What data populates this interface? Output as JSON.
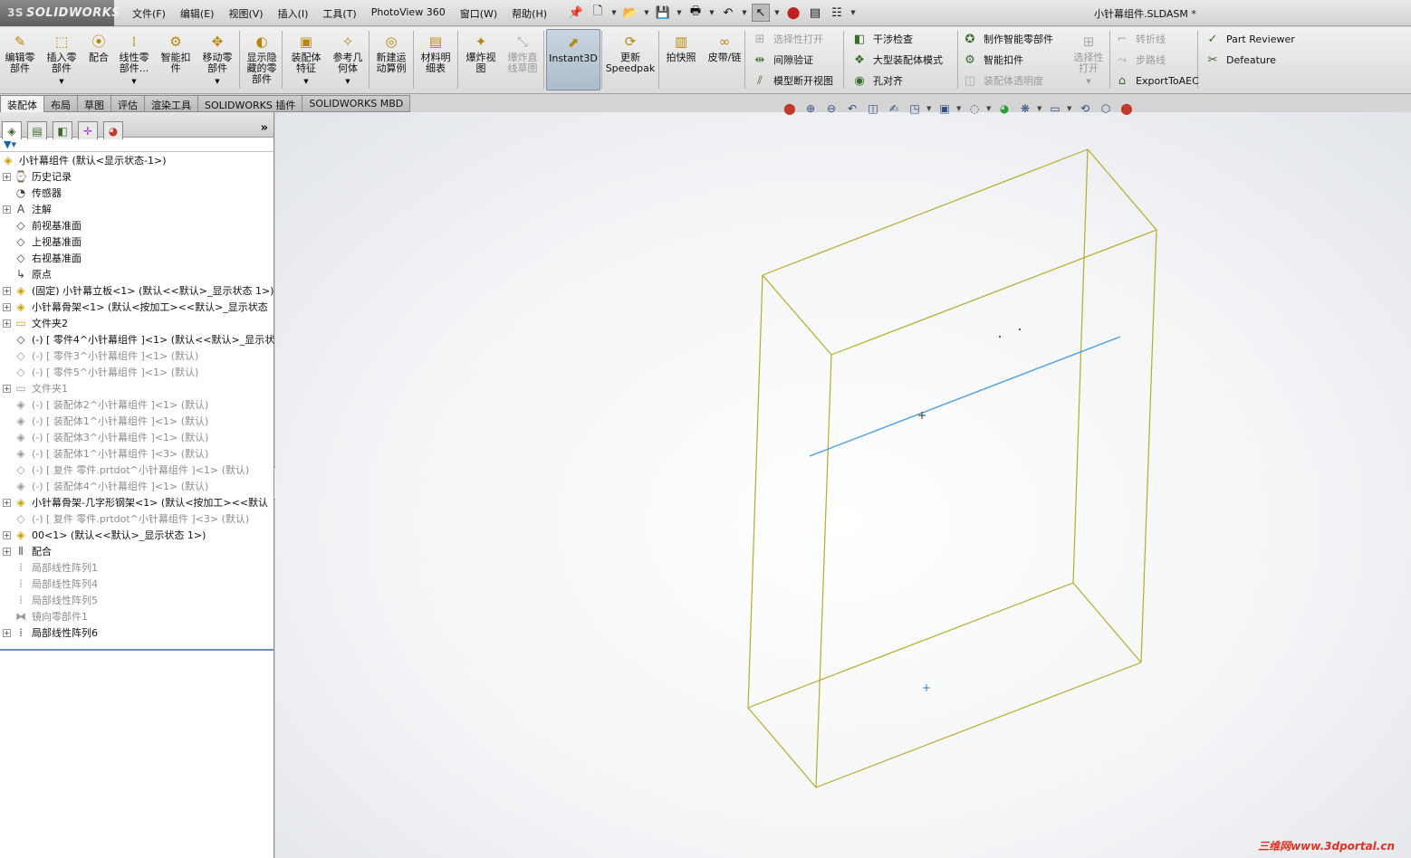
{
  "app": {
    "logo_text": "SOLIDWORKS",
    "logo_mark": "3S",
    "document_title": "小针幕组件.SLDASM *",
    "watermark": "三维网www.3dportal.cn"
  },
  "menu": [
    "文件(F)",
    "编辑(E)",
    "视图(V)",
    "插入(I)",
    "工具(T)",
    "PhotoView 360",
    "窗口(W)",
    "帮助(H)"
  ],
  "ribbon": {
    "large_buttons": [
      {
        "name": "edit-component-button",
        "label": "编辑零\n部件",
        "icon": "✎",
        "dropdown": false,
        "state": "normal"
      },
      {
        "name": "insert-components-button",
        "label": "插入零\n部件",
        "icon": "⬚",
        "dropdown": true,
        "state": "normal"
      },
      {
        "name": "mate-button",
        "label": "配合",
        "icon": "⦿",
        "dropdown": false,
        "state": "normal"
      },
      {
        "name": "linear-pattern-button",
        "label": "线性零\n部件...",
        "icon": "⁞",
        "dropdown": true,
        "state": "normal"
      },
      {
        "name": "smart-fasteners-button",
        "label": "智能扣\n件",
        "icon": "⚙",
        "dropdown": false,
        "state": "normal"
      },
      {
        "name": "move-component-button",
        "label": "移动零\n部件",
        "icon": "✥",
        "dropdown": true,
        "state": "normal"
      },
      {
        "name": "show-hidden-components-button",
        "label": "显示隐\n藏的零\n部件",
        "icon": "◐",
        "dropdown": false,
        "state": "normal"
      },
      {
        "name": "assembly-features-button",
        "label": "装配体\n特征",
        "icon": "▣",
        "dropdown": true,
        "state": "normal"
      },
      {
        "name": "reference-geometry-button",
        "label": "参考几\n何体",
        "icon": "✧",
        "dropdown": true,
        "state": "normal"
      },
      {
        "name": "new-motion-study-button",
        "label": "新建运\n动算例",
        "icon": "◎",
        "dropdown": false,
        "state": "normal"
      },
      {
        "name": "bill-of-materials-button",
        "label": "材料明\n细表",
        "icon": "▤",
        "dropdown": false,
        "state": "normal"
      },
      {
        "name": "exploded-view-button",
        "label": "爆炸视\n图",
        "icon": "✦",
        "dropdown": false,
        "state": "normal"
      },
      {
        "name": "explode-line-sketch-button",
        "label": "爆炸直\n线草图",
        "icon": "⤡",
        "dropdown": false,
        "state": "disabled"
      },
      {
        "name": "instant3d-button",
        "label": "Instant3D",
        "icon": "⬈",
        "dropdown": false,
        "state": "active"
      },
      {
        "name": "update-speedpak-button",
        "label": "更新\nSpeedpak",
        "icon": "⟳",
        "dropdown": false,
        "state": "normal"
      },
      {
        "name": "take-snapshot-button",
        "label": "拍快照",
        "icon": "▥",
        "dropdown": false,
        "state": "normal"
      },
      {
        "name": "belt-chain-button",
        "label": "皮带/链",
        "icon": "∞",
        "dropdown": false,
        "state": "normal"
      }
    ],
    "small_buttons": [
      {
        "name": "selective-open-button",
        "label": "选择性打开",
        "icon": "⊞",
        "state": "disabled"
      },
      {
        "name": "clearance-verification-button",
        "label": "间隙验证",
        "icon": "⇹",
        "state": "normal"
      },
      {
        "name": "model-break-view-button",
        "label": "模型断开视图",
        "icon": "⫽",
        "state": "normal"
      },
      {
        "name": "interference-detection-button",
        "label": "干涉检查",
        "icon": "◧",
        "state": "normal"
      },
      {
        "name": "large-assembly-mode-button",
        "label": "大型装配体模式",
        "icon": "❖",
        "state": "normal"
      },
      {
        "name": "hole-alignment-button",
        "label": "孔对齐",
        "icon": "◉",
        "state": "normal"
      },
      {
        "name": "make-smart-component-button",
        "label": "制作智能零部件",
        "icon": "✪",
        "state": "normal"
      },
      {
        "name": "smart-fasteners-small-button",
        "label": "智能扣件",
        "icon": "⚙",
        "state": "normal"
      },
      {
        "name": "assembly-transparency-button",
        "label": "装配体透明度",
        "icon": "◫",
        "state": "disabled"
      },
      {
        "name": "jog-line-button",
        "label": "转折线",
        "icon": "⌐",
        "state": "disabled"
      },
      {
        "name": "route-line-button",
        "label": "步路线",
        "icon": "⤳",
        "state": "disabled"
      },
      {
        "name": "export-to-aec-button",
        "label": "ExportToAEC",
        "icon": "⌂",
        "state": "normal"
      },
      {
        "name": "part-reviewer-button",
        "label": "Part Reviewer",
        "icon": "✓",
        "state": "normal"
      },
      {
        "name": "defeature-button",
        "label": "Defeature",
        "icon": "✂",
        "state": "normal"
      }
    ],
    "selective_open_large": {
      "label": "选择性\n打开",
      "state": "disabled"
    }
  },
  "tabs": [
    "装配体",
    "布局",
    "草图",
    "评估",
    "渲染工具",
    "SOLIDWORKS 插件",
    "SOLIDWORKS MBD"
  ],
  "feature_tree": [
    {
      "text": "小针幕组件  (默认<显示状态-1>)",
      "icon": "◈",
      "expand": false,
      "indent": 0,
      "grey": false
    },
    {
      "text": "历史记录",
      "icon": "⌚",
      "expand": true,
      "indent": 1,
      "grey": false
    },
    {
      "text": "传感器",
      "icon": "◔",
      "expand": false,
      "indent": 1,
      "grey": false
    },
    {
      "text": "注解",
      "icon": "A",
      "expand": true,
      "indent": 1,
      "grey": false
    },
    {
      "text": "前视基准面",
      "icon": "◇",
      "expand": false,
      "indent": 1,
      "grey": false
    },
    {
      "text": "上视基准面",
      "icon": "◇",
      "expand": false,
      "indent": 1,
      "grey": false
    },
    {
      "text": "右视基准面",
      "icon": "◇",
      "expand": false,
      "indent": 1,
      "grey": false
    },
    {
      "text": "原点",
      "icon": "↳",
      "expand": false,
      "indent": 1,
      "grey": false
    },
    {
      "text": "(固定) 小针幕立板<1> (默认<<默认>_显示状态 1>)",
      "icon": "◈",
      "expand": true,
      "indent": 1,
      "grey": false
    },
    {
      "text": "小针幕骨架<1> (默认<按加工><<默认>_显示状态",
      "icon": "◈",
      "expand": true,
      "indent": 1,
      "grey": false
    },
    {
      "text": "文件夹2",
      "icon": "▭",
      "expand": true,
      "indent": 1,
      "grey": false
    },
    {
      "text": "(-) [ 零件4^小针幕组件 ]<1> (默认<<默认>_显示状",
      "icon": "◇",
      "expand": false,
      "indent": 1,
      "grey": false
    },
    {
      "text": "(-) [ 零件3^小针幕组件 ]<1> (默认)",
      "icon": "◇",
      "expand": false,
      "indent": 1,
      "grey": true
    },
    {
      "text": "(-) [ 零件5^小针幕组件 ]<1> (默认)",
      "icon": "◇",
      "expand": false,
      "indent": 1,
      "grey": true
    },
    {
      "text": "文件夹1",
      "icon": "▭",
      "expand": true,
      "indent": 1,
      "grey": true
    },
    {
      "text": "(-) [ 装配体2^小针幕组件 ]<1> (默认)",
      "icon": "◈",
      "expand": false,
      "indent": 1,
      "grey": true
    },
    {
      "text": "(-) [ 装配体1^小针幕组件 ]<1> (默认)",
      "icon": "◈",
      "expand": false,
      "indent": 1,
      "grey": true
    },
    {
      "text": "(-) [ 装配体3^小针幕组件 ]<1> (默认)",
      "icon": "◈",
      "expand": false,
      "indent": 1,
      "grey": true
    },
    {
      "text": "(-) [ 装配体1^小针幕组件 ]<3> (默认)",
      "icon": "◈",
      "expand": false,
      "indent": 1,
      "grey": true
    },
    {
      "text": "(-) [ 复件 零件.prtdot^小针幕组件 ]<1> (默认)",
      "icon": "◇",
      "expand": false,
      "indent": 1,
      "grey": true
    },
    {
      "text": "(-) [ 装配体4^小针幕组件 ]<1> (默认)",
      "icon": "◈",
      "expand": false,
      "indent": 1,
      "grey": true
    },
    {
      "text": "小针幕骨架-几字形钢架<1> (默认<按加工><<默认",
      "icon": "◈",
      "expand": true,
      "indent": 1,
      "grey": false
    },
    {
      "text": "(-) [ 复件 零件.prtdot^小针幕组件 ]<3> (默认)",
      "icon": "◇",
      "expand": false,
      "indent": 1,
      "grey": true
    },
    {
      "text": "00<1> (默认<<默认>_显示状态 1>)",
      "icon": "◈",
      "expand": true,
      "indent": 1,
      "grey": false
    },
    {
      "text": "配合",
      "icon": "⫴",
      "expand": true,
      "indent": 1,
      "grey": false
    },
    {
      "text": "局部线性阵列1",
      "icon": "⁞",
      "expand": false,
      "indent": 1,
      "grey": true
    },
    {
      "text": "局部线性阵列4",
      "icon": "⁞",
      "expand": false,
      "indent": 1,
      "grey": true
    },
    {
      "text": "局部线性阵列5",
      "icon": "⁞",
      "expand": false,
      "indent": 1,
      "grey": true
    },
    {
      "text": "镜向零部件1",
      "icon": "⧓",
      "expand": false,
      "indent": 1,
      "grey": true
    },
    {
      "text": "局部线性阵列6",
      "icon": "⁞",
      "expand": true,
      "indent": 1,
      "grey": false
    }
  ],
  "panel": {
    "tabs": [
      {
        "name": "feature-manager-tab",
        "icon": "◈",
        "active": true
      },
      {
        "name": "property-manager-tab",
        "icon": "▤",
        "active": false
      },
      {
        "name": "configuration-manager-tab",
        "icon": "◧",
        "active": false
      },
      {
        "name": "dimxpert-tab",
        "icon": "✛",
        "active": false
      },
      {
        "name": "display-manager-tab",
        "icon": "◕",
        "active": false
      }
    ],
    "more": "»",
    "filter": "▼▾"
  },
  "heads_up_toolbar": [
    {
      "name": "view-visibility-icon",
      "icon": "⬤",
      "dd": false
    },
    {
      "name": "zoom-to-fit-icon",
      "icon": "⊕",
      "dd": false
    },
    {
      "name": "zoom-to-area-icon",
      "icon": "⊖",
      "dd": false
    },
    {
      "name": "previous-view-icon",
      "icon": "↶",
      "dd": false
    },
    {
      "name": "section-view-icon",
      "icon": "◫",
      "dd": false
    },
    {
      "name": "dynamic-annotation-icon",
      "icon": "✍",
      "dd": false
    },
    {
      "name": "view-orientation-icon",
      "icon": "◳",
      "dd": true
    },
    {
      "name": "display-style-icon",
      "icon": "▣",
      "dd": true
    },
    {
      "name": "hide-show-items-icon",
      "icon": "◌",
      "dd": true
    },
    {
      "name": "edit-appearance-icon",
      "icon": "◕",
      "dd": false
    },
    {
      "name": "apply-scene-icon",
      "icon": "❋",
      "dd": true
    },
    {
      "name": "view-settings-icon",
      "icon": "▭",
      "dd": true
    },
    {
      "name": "rotate-view-icon",
      "icon": "⟲",
      "dd": false
    },
    {
      "name": "3d-view-icon",
      "icon": "⬡",
      "dd": false
    },
    {
      "name": "display-pane-icon",
      "icon": "⬤",
      "dd": false
    }
  ],
  "scene": {
    "box_color": "#b4ac2c",
    "line_color": "#4a9ee0",
    "origin_color": "#3a7dc8"
  },
  "colors": {
    "active_tab_bg": "#f2f2f2",
    "disabled_text": "#9a9a9a",
    "tree_separator": "#6a8fc2"
  }
}
